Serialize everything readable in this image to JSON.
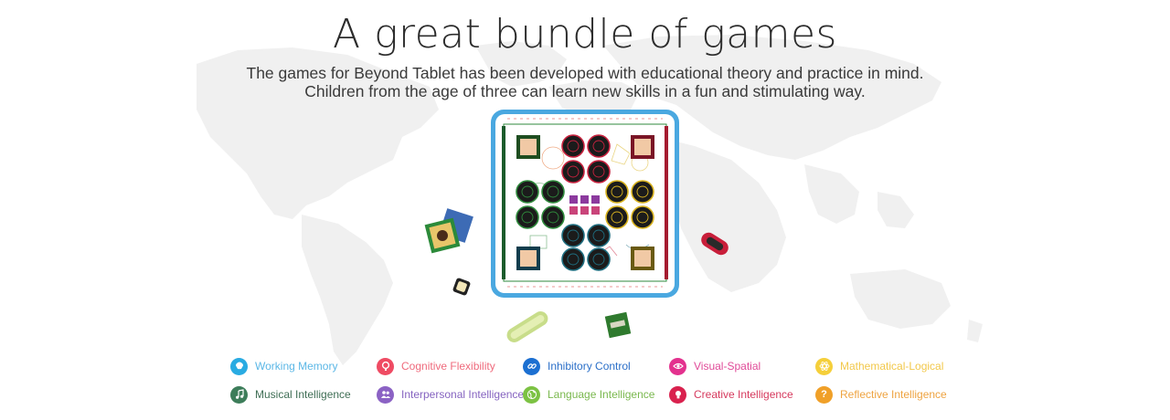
{
  "hero": {
    "title": "A great bundle of games",
    "subtitle_line1": "The games for Beyond Tablet has been developed with educational theory and practice in mind.",
    "subtitle_line2": "Children from the age of three can learn new skills in a fun and stimulating way."
  },
  "colors": {
    "map": "#f1f1f1",
    "board_frame": "#4aa8e0",
    "board_red": "#c8223f",
    "board_green": "#2f8a3c",
    "board_yellow": "#d9b31f",
    "board_teal": "#1f6e80"
  },
  "legend": [
    {
      "label": "Working Memory",
      "color": "#29abe2",
      "icon": "brain-icon"
    },
    {
      "label": "Cognitive Flexibility",
      "color": "#ef4b63",
      "icon": "head-icon"
    },
    {
      "label": "Inhibitory Control",
      "color": "#1b6fd1",
      "icon": "link-icon"
    },
    {
      "label": "Visual-Spatial",
      "color": "#e3318e",
      "icon": "eye-icon"
    },
    {
      "label": "Mathematical-Logical",
      "color": "#f5cf3a",
      "icon": "atom-icon"
    },
    {
      "label": "Musical Intelligence",
      "color": "#3d7d5a",
      "icon": "music-note-icon"
    },
    {
      "label": "Interpersonal Intelligence",
      "color": "#8b62c4",
      "icon": "people-icon"
    },
    {
      "label": "Language Intelligence",
      "color": "#7cc243",
      "icon": "globe-icon"
    },
    {
      "label": "Creative Intelligence",
      "color": "#d9214e",
      "icon": "lightbulb-icon"
    },
    {
      "label": "Reflective Intelligence",
      "color": "#f0a028",
      "icon": "question-icon"
    }
  ]
}
